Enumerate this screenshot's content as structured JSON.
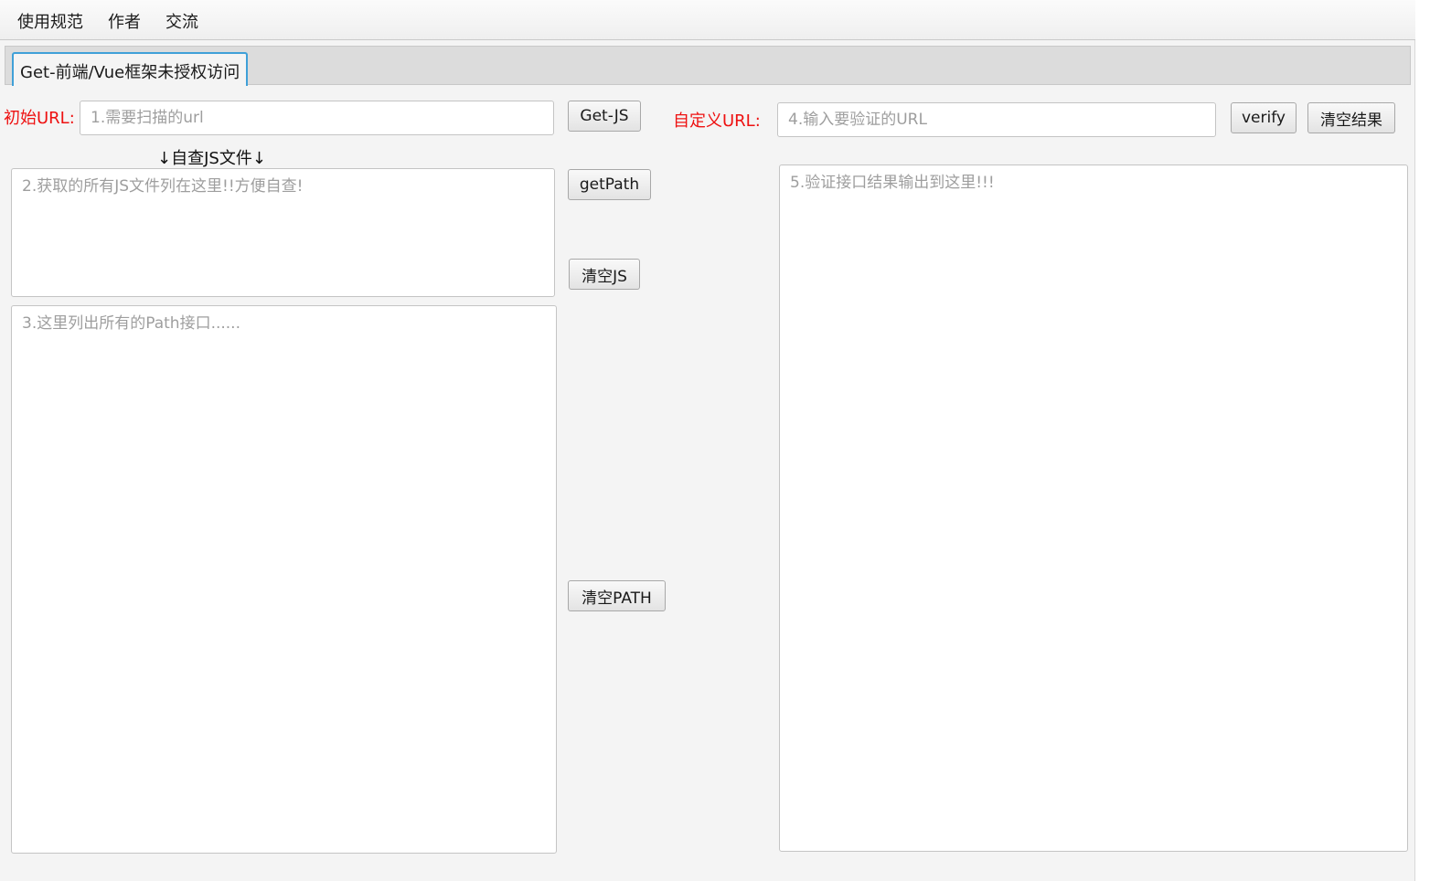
{
  "menu": {
    "items": [
      "使用规范",
      "作者",
      "交流"
    ]
  },
  "tabs": [
    {
      "label": "Get-前端/Vue框架未授权访问",
      "active": true
    }
  ],
  "left": {
    "initial_url_label": "初始URL:",
    "url_input": {
      "value": "",
      "placeholder": "1.需要扫描的url"
    },
    "get_js_button": "Get-JS",
    "js_section_label": "↓自查JS文件↓",
    "js_textarea": {
      "value": "",
      "placeholder": "2.获取的所有JS文件列在这里!!方便自查!"
    },
    "path_textarea": {
      "value": "",
      "placeholder": "3.这里列出所有的Path接口......"
    }
  },
  "middle": {
    "get_path_button": "getPath",
    "clear_js_button": "清空JS",
    "clear_path_button": "清空PATH"
  },
  "right": {
    "custom_url_label": "自定义URL:",
    "custom_url_input": {
      "value": "",
      "placeholder": "4.输入要验证的URL"
    },
    "verify_button": "verify",
    "clear_result_button": "清空结果",
    "result_textarea": {
      "value": "",
      "placeholder": "5.验证接口结果输出到这里!!!"
    }
  },
  "colors": {
    "label_accent": "#ee1111",
    "tab_focus": "#3fa0d8",
    "window_bg": "#f4f4f4"
  }
}
